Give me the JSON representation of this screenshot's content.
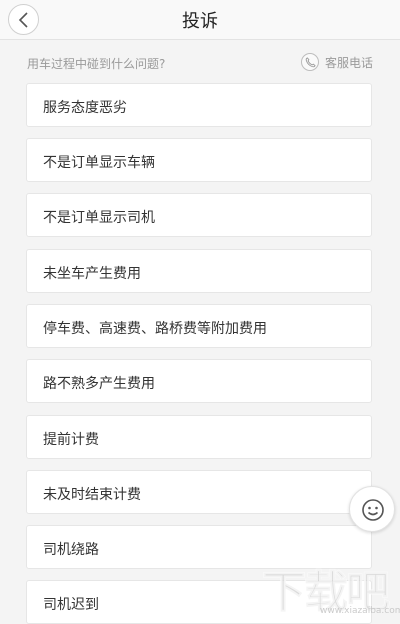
{
  "header": {
    "title": "投诉"
  },
  "question": "用车过程中碰到什么问题?",
  "hotline_label": "客服电话",
  "items": [
    {
      "label": "服务态度恶劣"
    },
    {
      "label": "不是订单显示车辆"
    },
    {
      "label": "不是订单显示司机"
    },
    {
      "label": "未坐车产生费用"
    },
    {
      "label": "停车费、高速费、路桥费等附加费用"
    },
    {
      "label": "路不熟多产生费用"
    },
    {
      "label": "提前计费"
    },
    {
      "label": "未及时结束计费"
    },
    {
      "label": "司机绕路"
    },
    {
      "label": "司机迟到"
    }
  ],
  "watermark": {
    "text": "下载吧",
    "url": "www.xiazaiba.com"
  },
  "icons": {
    "back": "chevron-left-icon",
    "phone": "phone-icon",
    "feedback": "smiley-icon"
  }
}
